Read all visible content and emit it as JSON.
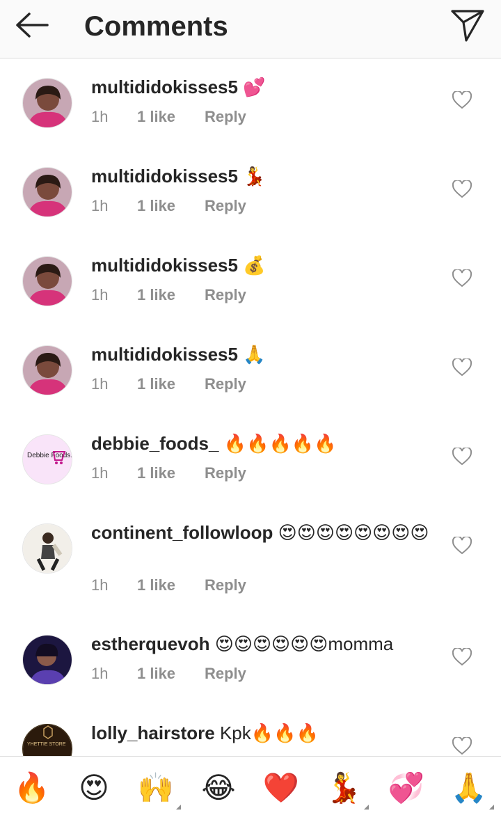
{
  "header": {
    "title": "Comments"
  },
  "comments": [
    {
      "username": "multididokisses5",
      "text": "💕",
      "time": "1h",
      "likes": "1 like",
      "reply": "Reply"
    },
    {
      "username": "multididokisses5",
      "text": "💃",
      "time": "1h",
      "likes": "1 like",
      "reply": "Reply"
    },
    {
      "username": "multididokisses5",
      "text": "💰",
      "time": "1h",
      "likes": "1 like",
      "reply": "Reply"
    },
    {
      "username": "multididokisses5",
      "text": "🙏",
      "time": "1h",
      "likes": "1 like",
      "reply": "Reply"
    },
    {
      "username": "debbie_foods_",
      "text": "🔥🔥🔥🔥🔥",
      "time": "1h",
      "likes": "1 like",
      "reply": "Reply",
      "avatar_text": "Debbie Foods..."
    },
    {
      "username": "continent_followloop",
      "text": "😍😍😍😍😍😍😍😍",
      "time": "1h",
      "likes": "1 like",
      "reply": "Reply"
    },
    {
      "username": "estherquevoh",
      "text": "😍😍😍😍😍😍momma",
      "time": "1h",
      "likes": "1 like",
      "reply": "Reply"
    },
    {
      "username": "lolly_hairstore",
      "text": "Kpk🔥🔥🔥",
      "avatar_text": "YHETTIE STORE"
    }
  ],
  "quick_reactions": [
    "🔥",
    "😍",
    "🙌",
    "😂",
    "❤️",
    "💃",
    "💞",
    "🙏"
  ],
  "colors": {
    "text": "#262626",
    "secondary": "#8e8e8e",
    "divider": "#dbdbdb",
    "header_bg": "#fafafa"
  }
}
